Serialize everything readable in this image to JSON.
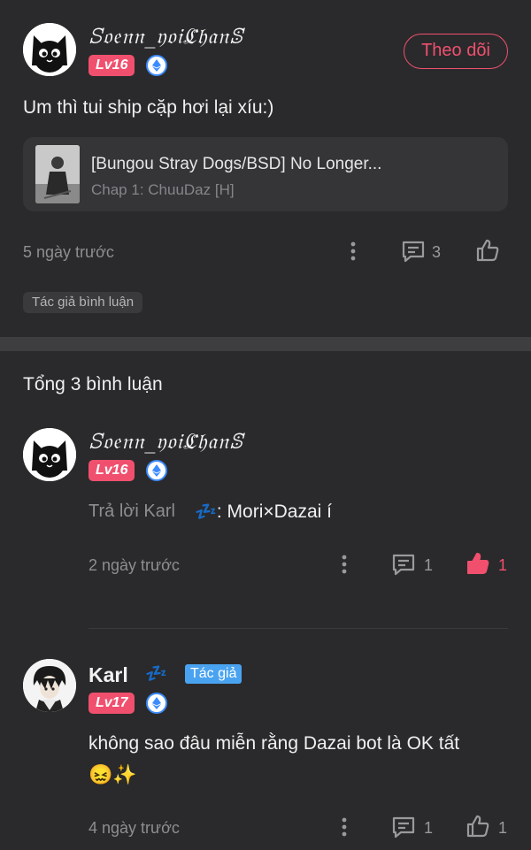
{
  "post": {
    "username": "ꕶ𝔬𝔢𝔫𝔫_𝔶𝔬𝔦ℭ𝔥𝔞𝔫ꕷ",
    "level": "Lv16",
    "follow_label": "Theo dõi",
    "content": "Um thì tui ship cặp hơi lại xíu:)",
    "card": {
      "title": "[Bungou Stray Dogs/BSD] No Longer...",
      "subtitle": "Chap 1: ChuuDaz [H]"
    },
    "time": "5 ngày trước",
    "comment_count": "3",
    "tag": "Tác giả bình luận"
  },
  "comments_header": "Tổng 3 bình luận",
  "comments": [
    {
      "username": "ꕶ𝔬𝔢𝔫𝔫_𝔶𝔬𝔦ℭ𝔥𝔞𝔫ꕷ",
      "level": "Lv16",
      "reply_prefix": "Trả lời Karl",
      "reply_emoji": "💤",
      "reply_text": ": Mori×Dazai í",
      "time": "2 ngày trước",
      "comment_count": "1",
      "like_count": "1",
      "liked": true
    },
    {
      "username": "Karl",
      "name_emoji": "💤",
      "author_tag": "Tác giả",
      "level": "Lv17",
      "text_line1": "không sao đâu miễn rằng Dazai bot là OK tất",
      "text_line2": "😖✨",
      "time": "4 ngày trước",
      "comment_count": "1",
      "like_count": "1",
      "liked": false
    }
  ],
  "colors": {
    "accent": "#f0506e",
    "background": "#2a2a2c",
    "level_badge": "#f0506e",
    "verified_ring": "#3c8cff",
    "author_tag": "#4aa3f0"
  },
  "icons": [
    "cat-avatar",
    "anime-avatar",
    "verified-icon",
    "more-vertical-icon",
    "comment-icon",
    "thumbs-up-icon"
  ]
}
